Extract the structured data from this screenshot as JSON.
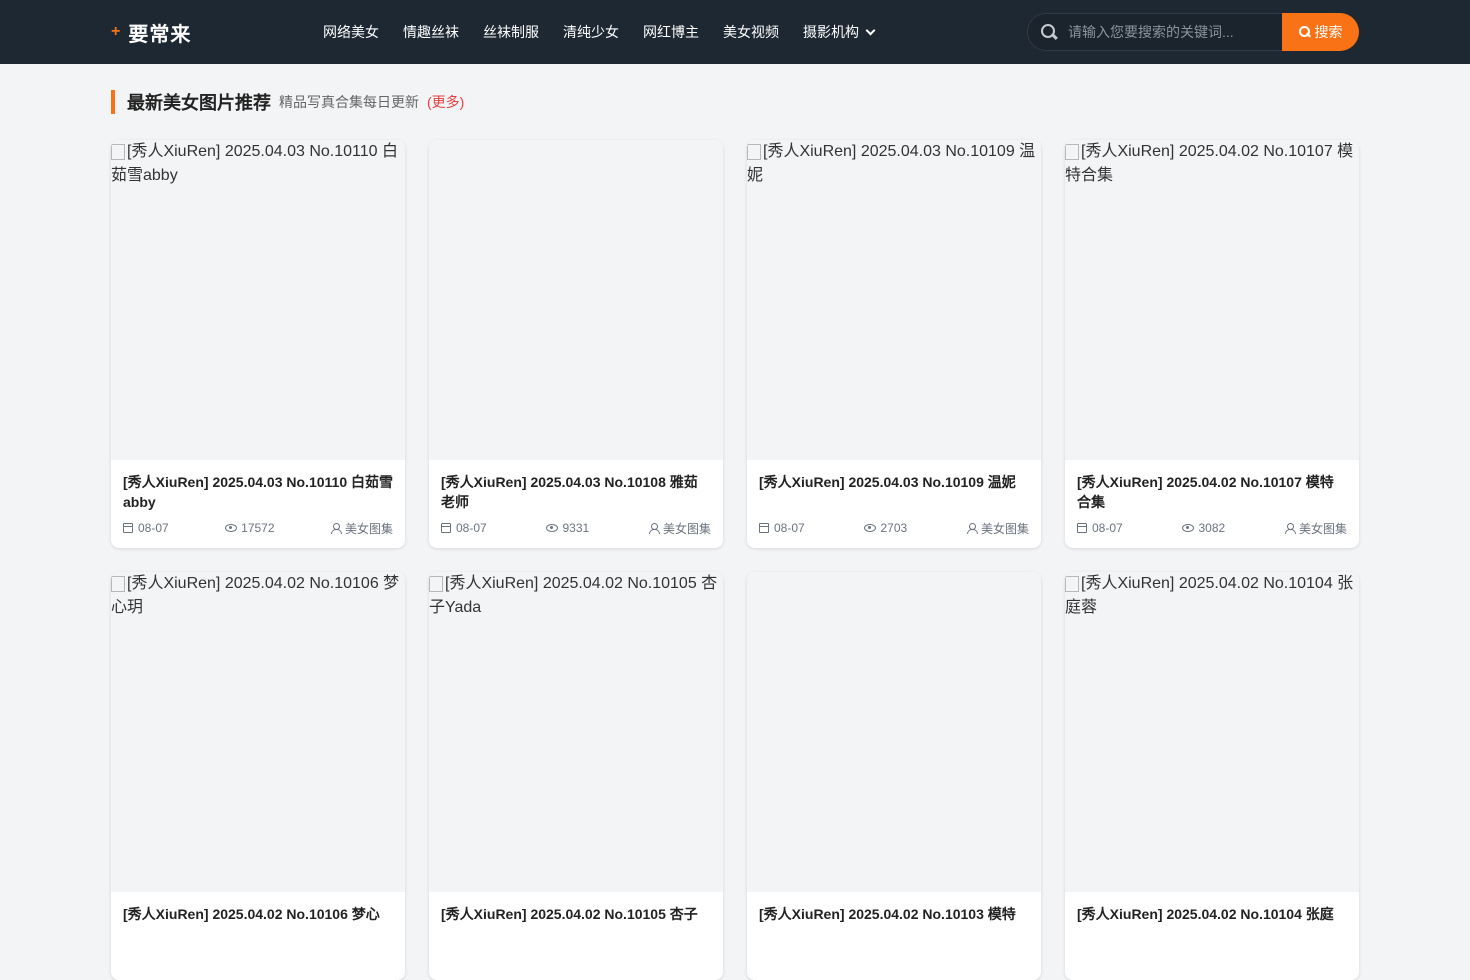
{
  "header": {
    "logo_plus": "+",
    "logo_text": "要常来",
    "nav": [
      {
        "label": "网络美女"
      },
      {
        "label": "情趣丝袜"
      },
      {
        "label": "丝袜制服"
      },
      {
        "label": "清纯少女"
      },
      {
        "label": "网红博主"
      },
      {
        "label": "美女视频"
      },
      {
        "label": "摄影机构"
      }
    ],
    "search_placeholder": "请输入您要搜索的关键词...",
    "search_button": "搜索"
  },
  "section": {
    "title": "最新美女图片推荐",
    "subtitle": "精品写真合集每日更新",
    "more": "(更多)"
  },
  "cards": [
    {
      "alt": "[秀人XiuRen] 2025.04.03 No.10110 白茹雪abby",
      "title": "[秀人XiuRen] 2025.04.03 No.10110 白茹雪abby",
      "date": "08-07",
      "views": "17572",
      "category": "美女图集"
    },
    {
      "alt": "",
      "title": "[秀人XiuRen] 2025.04.03 No.10108 雅茹老师",
      "date": "08-07",
      "views": "9331",
      "category": "美女图集"
    },
    {
      "alt": "[秀人XiuRen] 2025.04.03 No.10109 温妮",
      "title": "[秀人XiuRen] 2025.04.03 No.10109 温妮",
      "date": "08-07",
      "views": "2703",
      "category": "美女图集"
    },
    {
      "alt": "[秀人XiuRen] 2025.04.02 No.10107 模特合集",
      "title": "[秀人XiuRen] 2025.04.02 No.10107 模特合集",
      "date": "08-07",
      "views": "3082",
      "category": "美女图集"
    },
    {
      "alt": "[秀人XiuRen] 2025.04.02 No.10106 梦心玥",
      "title": "[秀人XiuRen] 2025.04.02 No.10106 梦心",
      "date": "",
      "views": "",
      "category": ""
    },
    {
      "alt": "[秀人XiuRen] 2025.04.02 No.10105 杏子Yada",
      "title": "[秀人XiuRen] 2025.04.02 No.10105 杏子",
      "date": "",
      "views": "",
      "category": ""
    },
    {
      "alt": "",
      "title": "[秀人XiuRen] 2025.04.02 No.10103 模特",
      "date": "",
      "views": "",
      "category": ""
    },
    {
      "alt": "[秀人XiuRen] 2025.04.02 No.10104 张庭蓉",
      "title": "[秀人XiuRen] 2025.04.02 No.10104 张庭",
      "date": "",
      "views": "",
      "category": ""
    }
  ]
}
